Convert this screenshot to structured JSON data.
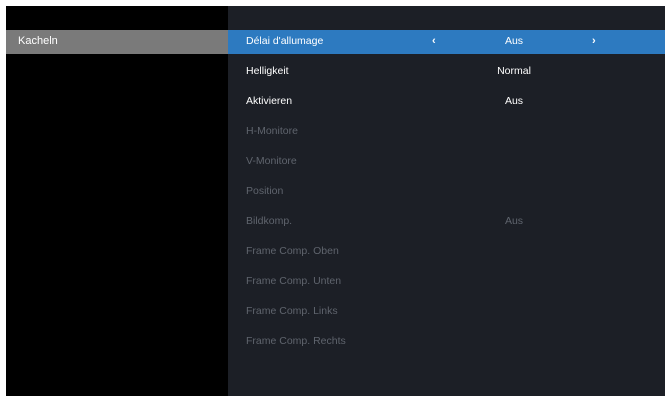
{
  "menu": {
    "left_item": "Kacheln"
  },
  "settings": [
    {
      "label": "Délai d'allumage",
      "value": "Aus",
      "state": "selected"
    },
    {
      "label": "Helligkeit",
      "value": "Normal",
      "state": "enabled"
    },
    {
      "label": "Aktivieren",
      "value": "Aus",
      "state": "enabled"
    },
    {
      "label": "H-Monitore",
      "value": "",
      "state": "disabled"
    },
    {
      "label": "V-Monitore",
      "value": "",
      "state": "disabled"
    },
    {
      "label": "Position",
      "value": "",
      "state": "disabled"
    },
    {
      "label": "Bildkomp.",
      "value": "Aus",
      "state": "disabled"
    },
    {
      "label": "Frame Comp. Oben",
      "value": "",
      "state": "disabled"
    },
    {
      "label": "Frame Comp. Unten",
      "value": "",
      "state": "disabled"
    },
    {
      "label": "Frame Comp. Links",
      "value": "",
      "state": "disabled"
    },
    {
      "label": "Frame Comp. Rechts",
      "value": "",
      "state": "disabled"
    }
  ],
  "arrows": {
    "left": "‹",
    "right": "›"
  },
  "colors": {
    "highlight": "#2d7ac0",
    "left_selected": "#7a7a7a",
    "panel": "#1c1f26",
    "disabled_text": "#5f646d"
  }
}
